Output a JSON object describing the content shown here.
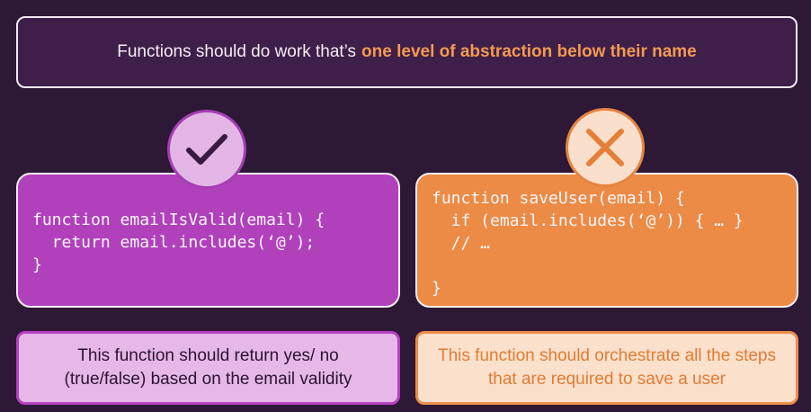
{
  "header": {
    "text_plain": "Functions should do work that’s",
    "text_highlight": "one level of abstraction below their name"
  },
  "good_example": {
    "icon": "check-icon",
    "code_lines": [
      "function emailIsValid(email) {",
      "  return email.includes(‘@’);",
      "}"
    ],
    "description": "This function should return yes/ no (true/false) based on the email validity"
  },
  "bad_example": {
    "icon": "cross-icon",
    "code_lines": [
      "function saveUser(email) {",
      "  if (email.includes(‘@’)) { … }",
      "  // …",
      "",
      "}"
    ],
    "description": "This function should orchestrate all the steps that are required to save a user"
  },
  "colors": {
    "background": "#2d1836",
    "accent_orange": "#f29a52",
    "good_purple": "#b041bb",
    "bad_orange": "#ec8b45"
  }
}
